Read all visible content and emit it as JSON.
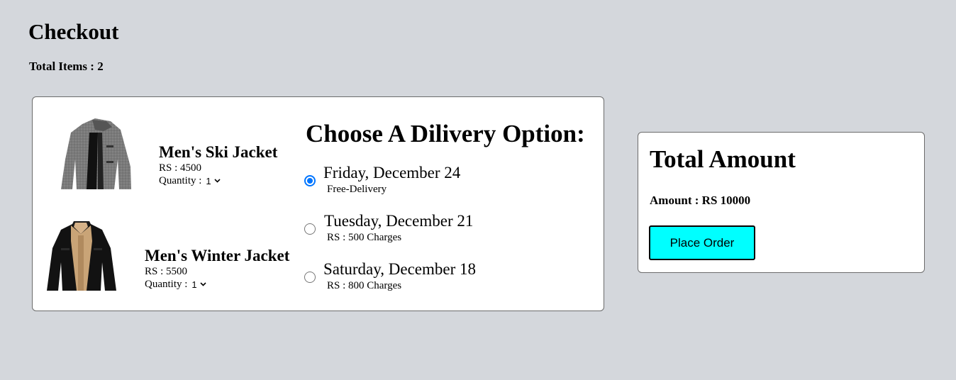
{
  "page": {
    "title": "Checkout",
    "total_items_label": "Total Items : ",
    "total_items_count": "2"
  },
  "cart": {
    "items": [
      {
        "name": "Men's Ski Jacket",
        "price": "RS : 4500",
        "quantity_label": "Quantity : ",
        "quantity_value": "1"
      },
      {
        "name": "Men's Winter Jacket",
        "price": "RS : 5500",
        "quantity_label": "Quantity : ",
        "quantity_value": "1"
      }
    ]
  },
  "delivery": {
    "heading": "Choose A Dilivery Option:",
    "options": [
      {
        "date": "Friday, December 24",
        "note": "Free-Delivery",
        "selected": true
      },
      {
        "date": "Tuesday, December 21",
        "note": "RS : 500 Charges",
        "selected": false
      },
      {
        "date": "Saturday, December 18",
        "note": "RS : 800 Charges",
        "selected": false
      }
    ]
  },
  "summary": {
    "title": "Total Amount",
    "amount_text": "Amount : RS 10000",
    "place_order_label": "Place Order"
  },
  "colors": {
    "background": "#d4d7dc",
    "button": "#00ffff",
    "radio_selected": "#0075ff"
  },
  "icons": [
    "chevron-down-icon",
    "jacket-image-grey",
    "jacket-image-black-sherpa"
  ]
}
